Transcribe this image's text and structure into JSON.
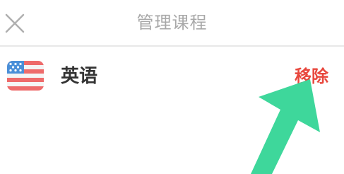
{
  "header": {
    "title": "管理课程",
    "close_icon": "close-icon"
  },
  "course": {
    "name": "英语",
    "flag_icon": "us-flag-icon",
    "remove_label": "移除"
  },
  "colors": {
    "remove": "#e8473d",
    "arrow": "#3ed79b",
    "title": "#a8a8a8",
    "close": "#b0b0b0"
  }
}
